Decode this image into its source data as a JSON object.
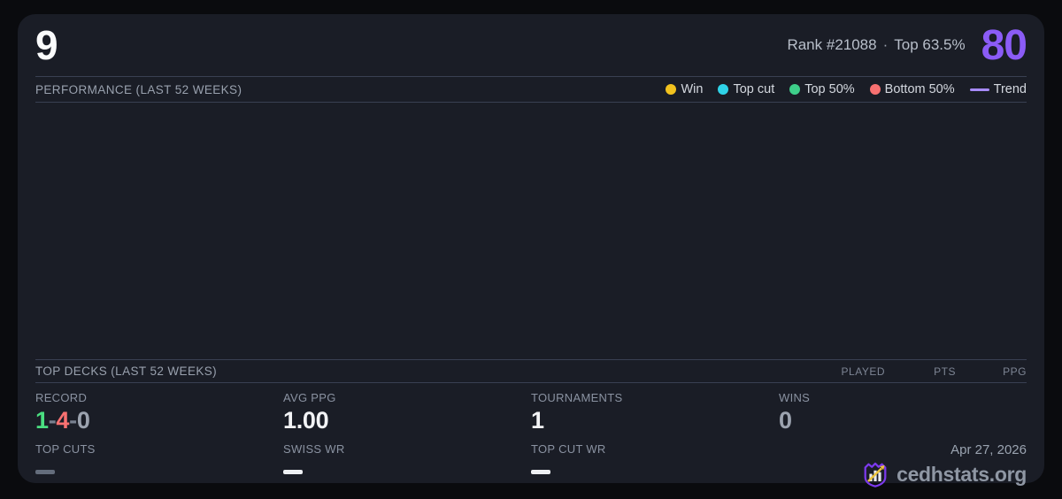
{
  "header": {
    "title": "9",
    "rank": "Rank #21088",
    "separator": "·",
    "top_percent": "Top 63.5%",
    "score": "80",
    "score_color": "#8b5cf6"
  },
  "performance": {
    "header": "PERFORMANCE (LAST 52 WEEKS)",
    "legend": [
      {
        "label": "Win",
        "color": "#f2c21e",
        "swatch": "dot"
      },
      {
        "label": "Top cut",
        "color": "#2fd3e8",
        "swatch": "dot"
      },
      {
        "label": "Top 50%",
        "color": "#3ecf8a",
        "swatch": "dot"
      },
      {
        "label": "Bottom 50%",
        "color": "#f87171",
        "swatch": "dot"
      },
      {
        "label": "Trend",
        "color": "#a78bfa",
        "swatch": "line"
      }
    ],
    "chart_data": {
      "type": "scatter",
      "points": [],
      "title": "PERFORMANCE (LAST 52 WEEKS)"
    }
  },
  "top_decks": {
    "header": "TOP DECKS (LAST 52 WEEKS)",
    "columns": [
      "PLAYED",
      "PTS",
      "PPG"
    ],
    "rows": []
  },
  "stats": {
    "record": {
      "label": "RECORD",
      "wins": "1",
      "sep1": "-",
      "losses": "4",
      "sep2": "-",
      "draws": "0",
      "wins_color": "#4ade80",
      "losses_color": "#f87171",
      "draws_color": "#9ca3af"
    },
    "avg_ppg": {
      "label": "AVG PPG",
      "value": "1.00"
    },
    "tournaments": {
      "label": "TOURNAMENTS",
      "value": "1"
    },
    "wins": {
      "label": "WINS",
      "value": "0"
    },
    "top_cuts": {
      "label": "TOP CUTS"
    },
    "swiss_wr": {
      "label": "SWISS WR"
    },
    "top_cut_wr": {
      "label": "TOP CUT WR"
    }
  },
  "footer": {
    "date": "Apr 27, 2026",
    "brand": "cedhstats.org",
    "logo_shield_color": "#7c3aed",
    "logo_arrow_color": "#eec53d"
  }
}
